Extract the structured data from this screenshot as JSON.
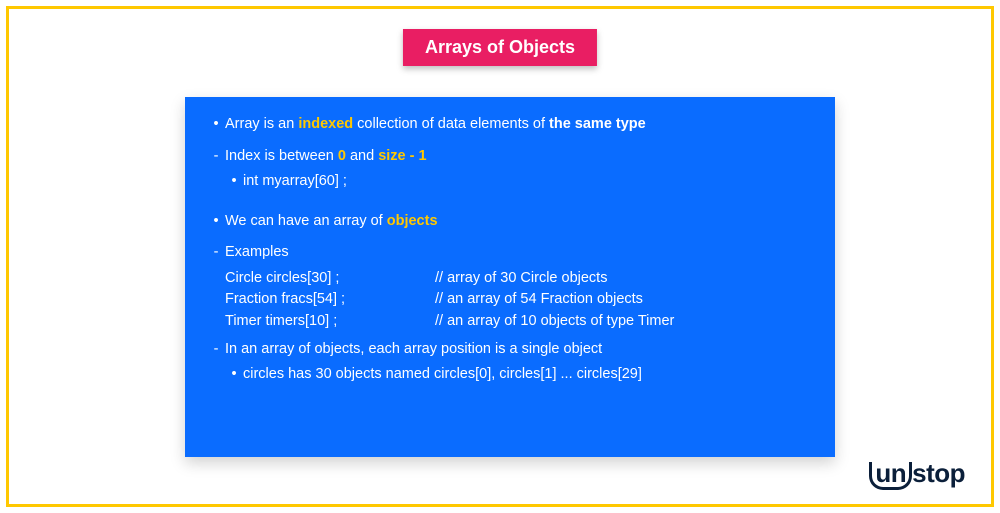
{
  "title": "Arrays of Objects",
  "line1": {
    "pre": "Array is an ",
    "hl": "indexed",
    "mid": " collection of data elements of ",
    "bold": "the same type"
  },
  "line2": {
    "pre": "Index is between ",
    "hl1": "0",
    "mid": " and ",
    "hl2": "size - 1"
  },
  "line3": "int myarray[60] ;",
  "line4": {
    "pre": "We can have an array of ",
    "hl": "objects"
  },
  "examplesLabel": "Examples",
  "examples": [
    {
      "decl": "Circle circles[30] ;",
      "comment": "// array of 30 Circle objects"
    },
    {
      "decl": "Fraction fracs[54] ;",
      "comment": "// an array of 54 Fraction objects"
    },
    {
      "decl": "Timer timers[10] ;",
      "comment": "// an array of 10 objects of type Timer"
    }
  ],
  "line5": "In an array of objects, each array position is a single object",
  "line6": "circles has 30 objects named circles[0], circles[1] ... circles[29]",
  "logo": {
    "un": "un",
    "stop": "stop"
  }
}
